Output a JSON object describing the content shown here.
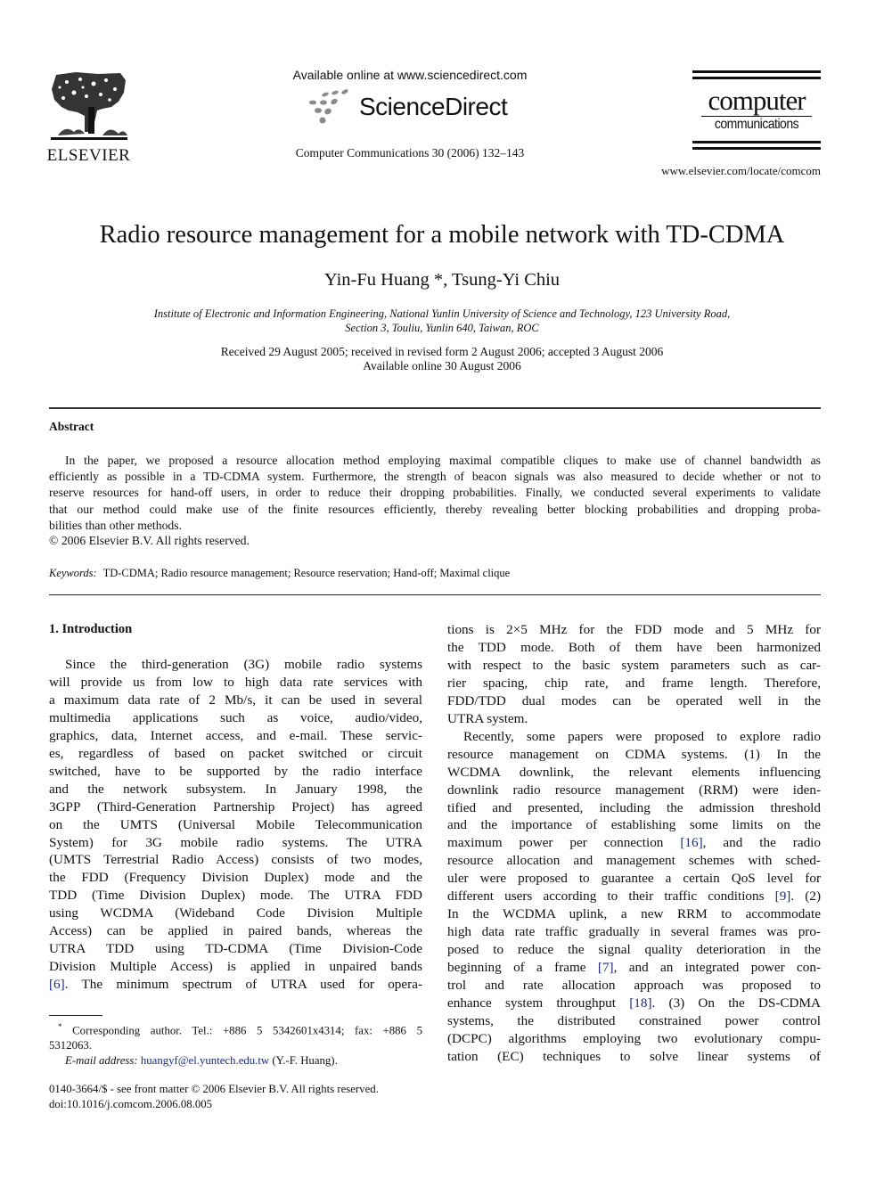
{
  "header": {
    "publisher_name": "ELSEVIER",
    "available_online": "Available online at www.sciencedirect.com",
    "sciencedirect_wordmark": "ScienceDirect",
    "journal_citation": "Computer Communications 30 (2006) 132–143",
    "journal_logo_line1": "computer",
    "journal_logo_line2": "communications",
    "journal_url": "www.elsevier.com/locate/comcom"
  },
  "article": {
    "title": "Radio resource management for a mobile network with TD-CDMA",
    "authors": "Yin-Fu Huang *, Tsung-Yi Chiu",
    "affiliation_line1": "Institute of Electronic and Information Engineering, National Yunlin University of Science and Technology, 123 University Road,",
    "affiliation_line2": "Section 3, Touliu, Yunlin 640, Taiwan, ROC",
    "dates_line1": "Received 29 August 2005; received in revised form 2 August 2006; accepted 3 August 2006",
    "dates_line2": "Available online 30 August 2006"
  },
  "abstract": {
    "heading": "Abstract",
    "lines": [
      "In the paper, we proposed a resource allocation method employing maximal compatible cliques to make use of channel bandwidth as",
      "efficiently as possible in a TD-CDMA system. Furthermore, the strength of beacon signals was also measured to decide whether or not to",
      "reserve resources for hand-off users, in order to reduce their dropping probabilities. Finally, we conducted several experiments to validate",
      "that our method could make use of the finite resources efficiently, thereby revealing better blocking probabilities and dropping proba-",
      "bilities than other methods."
    ],
    "copyright": "© 2006 Elsevier B.V. All rights reserved.",
    "keywords_label": "Keywords:",
    "keywords": "TD-CDMA; Radio resource management; Resource reservation; Hand-off; Maximal clique"
  },
  "introduction": {
    "heading": "1. Introduction",
    "left_lines": [
      "Since the third-generation (3G) mobile radio systems",
      "will provide us from low to high data rate services with",
      "a maximum data rate of 2 Mb/s, it can be used in several",
      "multimedia applications such as voice, audio/video,",
      "graphics, data, Internet access, and e-mail. These servic-",
      "es, regardless of based on packet switched or circuit",
      "switched, have to be supported by the radio interface",
      "and the network subsystem. In January 1998, the",
      "3GPP (Third-Generation Partnership Project) has agreed",
      "on the UMTS (Universal Mobile Telecommunication",
      "System) for 3G mobile radio systems. The UTRA",
      "(UMTS Terrestrial Radio Access) consists of two modes,",
      "the FDD (Frequency Division Duplex) mode and the",
      "TDD (Time Division Duplex) mode. The UTRA FDD",
      "using WCDMA (Wideband Code Division Multiple",
      "Access) can be applied in paired bands, whereas the",
      "UTRA TDD using TD-CDMA (Time Division-Code",
      "Division Multiple Access) is applied in unpaired bands"
    ],
    "left_last_ref": "[6]",
    "left_last_text": ". The minimum spectrum of UTRA used for opera-",
    "right_p1_lines": [
      "tions is 2×5 MHz for the FDD mode and 5 MHz for",
      "the TDD mode. Both of them have been harmonized",
      "with respect to the basic system parameters such as car-",
      "rier spacing, chip rate, and frame length. Therefore,",
      "FDD/TDD dual modes can be operated well in the",
      "UTRA system."
    ],
    "right_p2_lines": [
      "Recently, some papers were proposed to explore radio",
      "resource management on CDMA systems. (1) In the",
      "WCDMA downlink, the relevant elements influencing",
      "downlink radio resource management (RRM) were iden-",
      "tified and presented, including the admission threshold",
      "and the importance of establishing some limits on the"
    ],
    "line_ref16_pre": "maximum power per connection ",
    "ref16": "[16]",
    "line_ref16_post": ", and the radio",
    "line_sched": "resource allocation and management schemes with sched-",
    "line_qos": "uler were proposed to guarantee a certain QoS level for",
    "line_ref9_pre": "different users according to their traffic conditions ",
    "ref9": "[9]",
    "line_ref9_post": ". (2)",
    "line_uplink": "In the WCDMA uplink, a new RRM to accommodate",
    "line_hdr": "high data rate traffic gradually in several frames was pro-",
    "line_posed": "posed to reduce the signal quality deterioration in the",
    "line_ref7_pre": "beginning of a frame ",
    "ref7": "[7]",
    "line_ref7_post": ", and an integrated power con-",
    "line_trol": "trol and rate allocation approach was proposed to",
    "line_ref18_pre": "enhance system throughput ",
    "ref18": "[18]",
    "line_ref18_post": ". (3) On the DS-CDMA",
    "line_systems": "systems, the distributed constrained power control",
    "line_dcpc": "(DCPC) algorithms employing two evolutionary compu-",
    "line_tation": "tation (EC) techniques to solve linear systems of"
  },
  "footnote": {
    "marker": "*",
    "line1": "Corresponding author. Tel.: +886 5 5342601x4314; fax: +886 5",
    "line2": "5312063.",
    "email_label": "E-mail address:",
    "email": "huangyf@el.yuntech.edu.tw",
    "email_suffix": " (Y.-F. Huang)."
  },
  "front_matter": {
    "issn_line": "0140-3664/$ - see front matter © 2006 Elsevier B.V. All rights reserved.",
    "doi": "doi:10.1016/j.comcom.2006.08.005"
  },
  "colors": {
    "link": "#1a2a8c",
    "text": "#111111",
    "logo_grey": "#8a8a8a"
  }
}
